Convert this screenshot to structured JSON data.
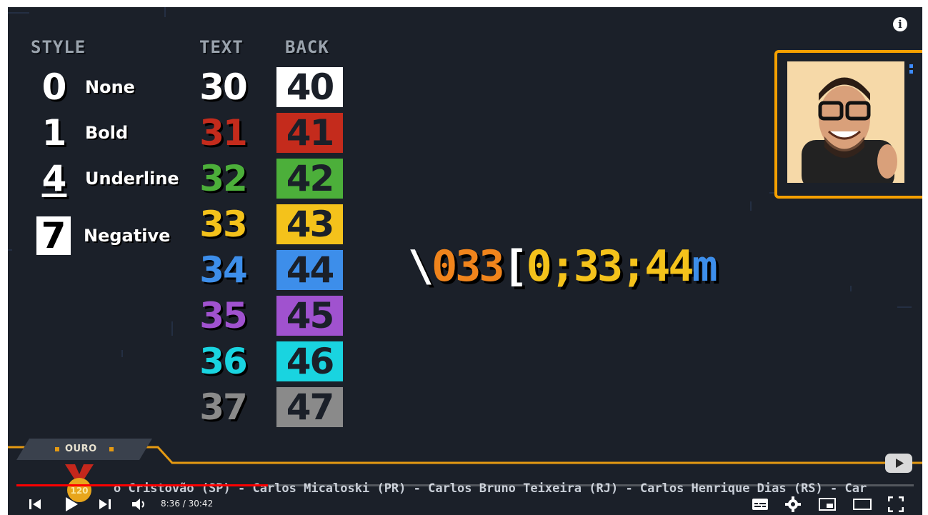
{
  "video": {
    "headers": {
      "style": "STYLE",
      "text": "TEXT",
      "back": "BACK"
    },
    "styles": [
      {
        "code": "0",
        "label": "None"
      },
      {
        "code": "1",
        "label": "Bold"
      },
      {
        "code": "4",
        "label": "Underline"
      },
      {
        "code": "7",
        "label": "Negative"
      }
    ],
    "text_colors": [
      {
        "code": "30",
        "color": "#ffffff"
      },
      {
        "code": "31",
        "color": "#c42b1c"
      },
      {
        "code": "32",
        "color": "#4caf3a"
      },
      {
        "code": "33",
        "color": "#f4c21b"
      },
      {
        "code": "34",
        "color": "#3d8eea"
      },
      {
        "code": "35",
        "color": "#a052cf"
      },
      {
        "code": "36",
        "color": "#19d4e0"
      },
      {
        "code": "37",
        "color": "#8a8a8a"
      }
    ],
    "back_colors": [
      {
        "code": "40",
        "color": "#ffffff"
      },
      {
        "code": "41",
        "color": "#c42b1c"
      },
      {
        "code": "42",
        "color": "#4caf3a"
      },
      {
        "code": "43",
        "color": "#f4c21b"
      },
      {
        "code": "44",
        "color": "#3d8eea"
      },
      {
        "code": "45",
        "color": "#a052cf"
      },
      {
        "code": "46",
        "color": "#19d4e0"
      },
      {
        "code": "47",
        "color": "#8a8a8a"
      }
    ],
    "ansi_sequence": {
      "backslash": "\\",
      "prefix": "033",
      "bracket": "[",
      "codes": "0;33;44",
      "terminator": "m"
    },
    "banner": {
      "tier": "OURO",
      "medal_number": "120",
      "ticker": "o Cristovão (SP) - Carlos Micaloski (PR) - Carlos Bruno Teixeira (RJ) - Carlos Henrique Dias (RS) - Car"
    }
  },
  "player": {
    "current_time": "8:36",
    "duration": "30:42",
    "time_display": "8:36 / 30:42",
    "progress_fraction": 0.28,
    "accent_color": "#ff0000",
    "icons": [
      "prev-icon",
      "play-icon",
      "next-icon",
      "volume-icon",
      "subtitles-icon",
      "settings-icon",
      "miniplayer-icon",
      "theater-icon",
      "fullscreen-icon",
      "info-icon",
      "youtube-icon"
    ]
  }
}
